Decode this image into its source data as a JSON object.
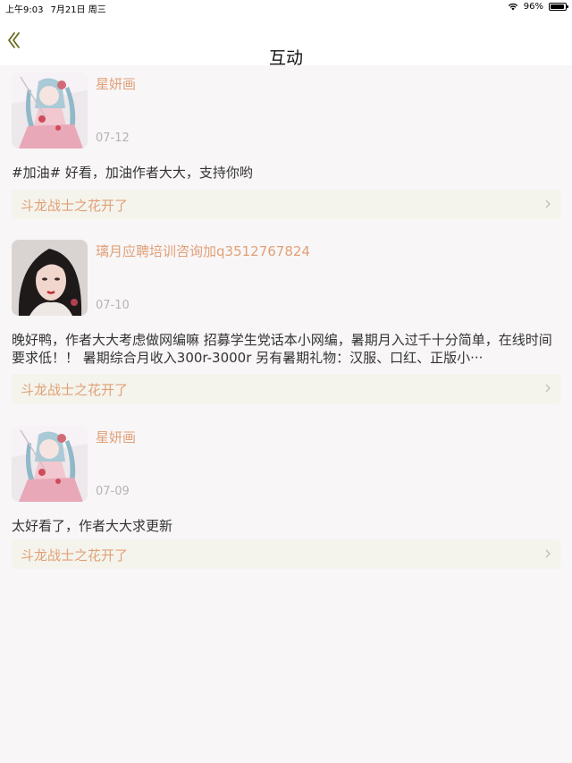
{
  "status": {
    "time": "上午9:03",
    "date": "7月21日 周三",
    "battery": "96%",
    "battery_level": 0.96
  },
  "nav": {
    "title": "互动"
  },
  "items": [
    {
      "username": "星妍画",
      "date": "07-12",
      "comment": "#加油# 好看，加油作者大大，支持你哟",
      "book": "斗龙战士之花开了",
      "avatar": "anime-girl"
    },
    {
      "username": "璃月应聘培训咨询加q3512767824",
      "date": "07-10",
      "comment": "晚好鸭，作者大大考虑做网编嘛 招募学生党话本小网编，暑期月入过千十分简单，在线时间要求低！！ 暑期综合月收入300r-3000r 另有暑期礼物：汉服、口红、正版小···",
      "book": "斗龙战士之花开了",
      "avatar": "portrait-woman"
    },
    {
      "username": "星妍画",
      "date": "07-09",
      "comment": "太好看了，作者大大求更新",
      "book": "斗龙战士之花开了",
      "avatar": "anime-girl"
    }
  ],
  "colors": {
    "accent": "#e0a078",
    "date": "#b5b5b5",
    "book_bg": "#f4f4ec",
    "page_bg": "#f8f6f7"
  }
}
